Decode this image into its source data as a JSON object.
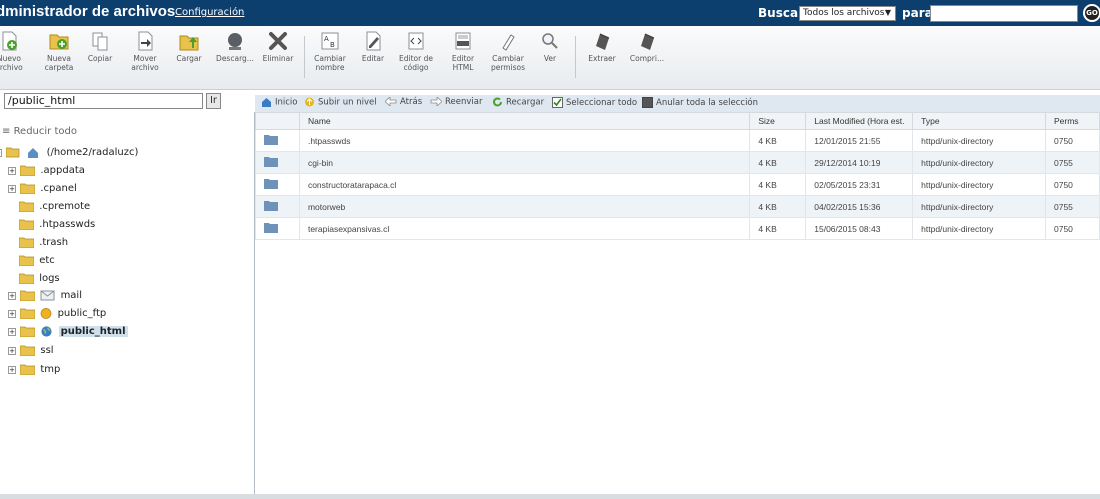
{
  "header": {
    "title": "dministrador de archivos",
    "config_link": "Configuración",
    "search_label": "Buscar",
    "search_scope": "Todos los archivos",
    "para_label": "para",
    "search_value": "",
    "go_label": "GO"
  },
  "toolbar": {
    "items": [
      {
        "label": "Nuevo\narchivo",
        "icon": "new-file-icon"
      },
      {
        "label": "Nueva\ncarpeta",
        "icon": "new-folder-icon"
      },
      {
        "label": "Copiar",
        "icon": "copy-icon"
      },
      {
        "label": "Mover\narchivo",
        "icon": "move-icon"
      },
      {
        "label": "Cargar",
        "icon": "upload-icon"
      },
      {
        "label": "Descarg...",
        "icon": "download-icon"
      },
      {
        "label": "Eliminar",
        "icon": "delete-icon"
      },
      {
        "label": "Cambiar\nnombre",
        "icon": "rename-icon"
      },
      {
        "label": "Editar",
        "icon": "edit-icon"
      },
      {
        "label": "Editor de\ncódigo",
        "icon": "code-editor-icon"
      },
      {
        "label": "Editor\nHTML",
        "icon": "html-editor-icon"
      },
      {
        "label": "Cambiar\npermisos",
        "icon": "permissions-icon"
      },
      {
        "label": "Ver",
        "icon": "view-icon"
      },
      {
        "label": "Extraer",
        "icon": "extract-icon"
      },
      {
        "label": "Compri...",
        "icon": "compress-icon"
      }
    ]
  },
  "path": {
    "value": "/public_html",
    "go_label": "Ir"
  },
  "sidebar": {
    "collapse_all": "Reducir todo",
    "root": "(/home2/radaluzc)",
    "tree": [
      {
        "name": ".appdata",
        "expandable": true
      },
      {
        "name": ".cpanel",
        "expandable": true
      },
      {
        "name": ".cpremote",
        "expandable": false
      },
      {
        "name": ".htpasswds",
        "expandable": false
      },
      {
        "name": ".trash",
        "expandable": false
      },
      {
        "name": "etc",
        "expandable": false
      },
      {
        "name": "logs",
        "expandable": false
      },
      {
        "name": "mail",
        "expandable": true
      },
      {
        "name": "public_ftp",
        "expandable": true
      },
      {
        "name": "public_html",
        "expandable": true,
        "selected": true
      },
      {
        "name": "ssl",
        "expandable": true
      },
      {
        "name": "tmp",
        "expandable": true
      }
    ]
  },
  "navbar": {
    "home": "Inicio",
    "up": "Subir un nivel",
    "back": "Atrás",
    "forward": "Reenviar",
    "reload": "Recargar",
    "select_all": "Seleccionar todo",
    "deselect_all": "Anular toda la selección"
  },
  "table": {
    "columns": [
      "Name",
      "Size",
      "Last Modified (Hora est.",
      "Type",
      "Perms"
    ],
    "rows": [
      {
        "name": ".htpasswds",
        "size": "4 KB",
        "modified": "12/01/2015 21:55",
        "type": "httpd/unix-directory",
        "perms": "0750"
      },
      {
        "name": "cgi-bin",
        "size": "4 KB",
        "modified": "29/12/2014 10:19",
        "type": "httpd/unix-directory",
        "perms": "0755"
      },
      {
        "name": "constructoratarapaca.cl",
        "size": "4 KB",
        "modified": "02/05/2015 23:31",
        "type": "httpd/unix-directory",
        "perms": "0750"
      },
      {
        "name": "motorweb",
        "size": "4 KB",
        "modified": "04/02/2015 15:36",
        "type": "httpd/unix-directory",
        "perms": "0755"
      },
      {
        "name": "terapiasexpansivas.cl",
        "size": "4 KB",
        "modified": "15/06/2015 08:43",
        "type": "httpd/unix-directory",
        "perms": "0750"
      }
    ]
  },
  "colors": {
    "header_bg": "#0d3f6e",
    "navbar_bg": "#dfe8f1",
    "folder": "#e8c24a",
    "row_folder": "#6f93b8"
  }
}
